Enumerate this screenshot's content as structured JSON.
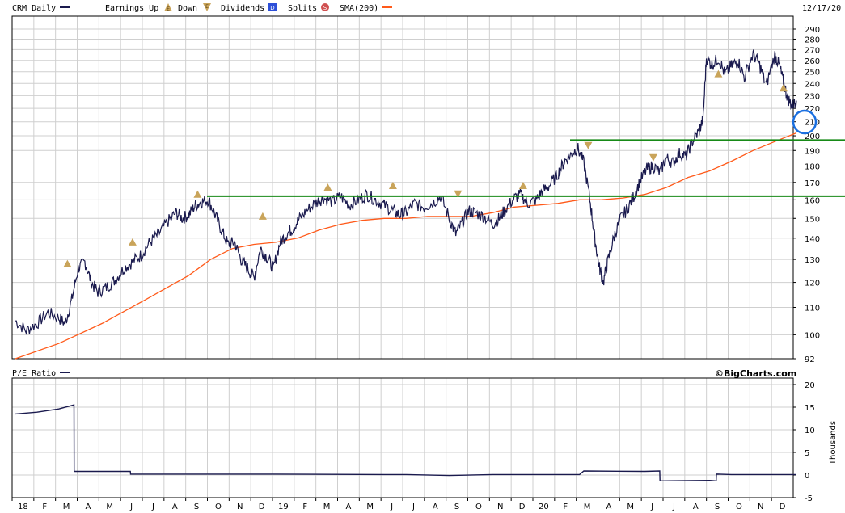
{
  "header": {
    "ticker_label": "CRM Daily",
    "earnings_label": "Earnings Up",
    "down_label": "Down",
    "dividends_label": "Dividends",
    "splits_label": "Splits",
    "sma_label": "SMA(200)",
    "date_label": "12/17/20",
    "earnings_icon": "E",
    "dividends_icon": "D",
    "splits_icon": "S"
  },
  "lower": {
    "pe_label": "P/E Ratio",
    "brand": "©BigCharts.com",
    "unit_label": "Thousands"
  },
  "colors": {
    "price": "#1a1a4e",
    "sma": "#ff5a1a",
    "trendline": "#178a17",
    "earnings_marker": "#c9a45a",
    "dividend": "#2d4fd8",
    "split": "#d05050",
    "highlight": "#1a6fe0",
    "grid": "#cfcfcf"
  },
  "chart_data": [
    {
      "type": "line",
      "name": "CRM Daily price chart",
      "y_scale": "log",
      "ylim": [
        92,
        290
      ],
      "y_ticks": [
        92,
        100,
        110,
        120,
        130,
        140,
        150,
        160,
        170,
        180,
        190,
        200,
        210,
        220,
        230,
        240,
        250,
        260,
        270,
        280,
        290
      ],
      "x_ticks": [
        "18",
        "F",
        "M",
        "A",
        "M",
        "J",
        "J",
        "A",
        "S",
        "O",
        "N",
        "D",
        "19",
        "F",
        "M",
        "A",
        "M",
        "J",
        "J",
        "A",
        "S",
        "O",
        "N",
        "D",
        "20",
        "F",
        "M",
        "A",
        "M",
        "J",
        "J",
        "A",
        "S",
        "O",
        "N",
        "D"
      ],
      "series": [
        {
          "name": "CRM Daily",
          "points": [
            [
              0,
              105
            ],
            [
              0.5,
              101.5
            ],
            [
              1,
              104
            ],
            [
              1.5,
              108
            ],
            [
              2,
              106
            ],
            [
              2.3,
              104
            ],
            [
              2.6,
              113
            ],
            [
              2.9,
              126
            ],
            [
              3.2,
              129
            ],
            [
              3.5,
              120
            ],
            [
              3.8,
              116
            ],
            [
              4.2,
              118
            ],
            [
              4.6,
              121
            ],
            [
              5,
              126
            ],
            [
              5.4,
              129
            ],
            [
              5.8,
              132
            ],
            [
              6.2,
              138
            ],
            [
              6.6,
              142
            ],
            [
              7,
              148
            ],
            [
              7.4,
              153
            ],
            [
              7.7,
              150
            ],
            [
              8,
              152
            ],
            [
              8.3,
              157
            ],
            [
              8.6,
              159
            ],
            [
              8.9,
              160
            ],
            [
              9.2,
              152
            ],
            [
              9.5,
              144
            ],
            [
              9.8,
              137
            ],
            [
              10.1,
              138
            ],
            [
              10.4,
              130
            ],
            [
              10.7,
              126
            ],
            [
              11,
              122
            ],
            [
              11.3,
              135
            ],
            [
              11.6,
              131
            ],
            [
              11.9,
              126
            ],
            [
              12.2,
              138
            ],
            [
              12.5,
              142
            ],
            [
              12.8,
              145
            ],
            [
              13.1,
              150
            ],
            [
              13.5,
              155
            ],
            [
              13.9,
              159
            ],
            [
              14.2,
              161
            ],
            [
              14.6,
              159
            ],
            [
              15,
              162
            ],
            [
              15.4,
              157
            ],
            [
              15.8,
              160
            ],
            [
              16.2,
              163
            ],
            [
              16.6,
              160
            ],
            [
              17,
              157
            ],
            [
              17.4,
              154
            ],
            [
              17.7,
              152
            ],
            [
              18,
              153
            ],
            [
              18.4,
              158
            ],
            [
              18.8,
              156
            ],
            [
              19.2,
              158
            ],
            [
              19.6,
              162
            ],
            [
              20,
              150
            ],
            [
              20.3,
              142
            ],
            [
              20.6,
              148
            ],
            [
              20.9,
              154
            ],
            [
              21.2,
              153
            ],
            [
              21.6,
              151
            ],
            [
              22,
              147
            ],
            [
              22.3,
              150
            ],
            [
              22.6,
              155
            ],
            [
              23,
              161
            ],
            [
              23.3,
              163
            ],
            [
              23.6,
              158
            ],
            [
              24,
              160
            ],
            [
              24.3,
              165
            ],
            [
              24.6,
              168
            ],
            [
              25,
              175
            ],
            [
              25.3,
              183
            ],
            [
              25.6,
              187
            ],
            [
              25.9,
              192
            ],
            [
              26.2,
              182
            ],
            [
              26.5,
              158
            ],
            [
              26.7,
              140
            ],
            [
              26.9,
              127
            ],
            [
              27.1,
              120
            ],
            [
              27.3,
              129
            ],
            [
              27.6,
              141
            ],
            [
              27.9,
              150
            ],
            [
              28.2,
              155
            ],
            [
              28.5,
              162
            ],
            [
              28.8,
              171
            ],
            [
              29.1,
              178
            ],
            [
              29.4,
              180
            ],
            [
              29.7,
              176
            ],
            [
              30,
              185
            ],
            [
              30.3,
              182
            ],
            [
              30.6,
              188
            ],
            [
              30.9,
              186
            ],
            [
              31.2,
              196
            ],
            [
              31.5,
              203
            ],
            [
              31.7,
              212
            ],
            [
              31.85,
              262
            ],
            [
              32.1,
              256
            ],
            [
              32.4,
              262
            ],
            [
              32.7,
              248
            ],
            [
              33,
              255
            ],
            [
              33.3,
              260
            ],
            [
              33.6,
              245
            ],
            [
              34,
              266
            ],
            [
              34.3,
              256
            ],
            [
              34.6,
              238
            ],
            [
              35,
              265
            ],
            [
              35.2,
              256
            ],
            [
              35.4,
              241
            ],
            [
              35.6,
              228
            ],
            [
              35.8,
              222
            ],
            [
              36,
              226
            ]
          ]
        },
        {
          "name": "SMA(200)",
          "points": [
            [
              0,
              92
            ],
            [
              2,
              97
            ],
            [
              4,
              104
            ],
            [
              6,
              113
            ],
            [
              8,
              123
            ],
            [
              9,
              130
            ],
            [
              10,
              135
            ],
            [
              11,
              137
            ],
            [
              12,
              138
            ],
            [
              13,
              140
            ],
            [
              14,
              144
            ],
            [
              15,
              147
            ],
            [
              16,
              149
            ],
            [
              17,
              150
            ],
            [
              18,
              150
            ],
            [
              19,
              151
            ],
            [
              20,
              151
            ],
            [
              21,
              151
            ],
            [
              22,
              153
            ],
            [
              23,
              156
            ],
            [
              24,
              157
            ],
            [
              25,
              158
            ],
            [
              26,
              160
            ],
            [
              27,
              160
            ],
            [
              28,
              161
            ],
            [
              29,
              163
            ],
            [
              30,
              167
            ],
            [
              31,
              173
            ],
            [
              32,
              177
            ],
            [
              33,
              183
            ],
            [
              34,
              190
            ],
            [
              35,
              196
            ],
            [
              36,
              202
            ]
          ]
        }
      ],
      "trendlines": [
        {
          "name": "resistance 162",
          "y": 162
        },
        {
          "name": "resistance 197",
          "y": 197
        }
      ],
      "earnings_markers": [
        {
          "x": 2.4,
          "y": 128,
          "dir": "up"
        },
        {
          "x": 5.4,
          "y": 138,
          "dir": "up"
        },
        {
          "x": 8.4,
          "y": 163,
          "dir": "up"
        },
        {
          "x": 11.4,
          "y": 151,
          "dir": "up"
        },
        {
          "x": 14.4,
          "y": 167,
          "dir": "up"
        },
        {
          "x": 17.4,
          "y": 168,
          "dir": "up"
        },
        {
          "x": 20.4,
          "y": 163,
          "dir": "down"
        },
        {
          "x": 23.4,
          "y": 168,
          "dir": "up"
        },
        {
          "x": 26.4,
          "y": 193,
          "dir": "down"
        },
        {
          "x": 29.4,
          "y": 185,
          "dir": "down"
        },
        {
          "x": 32.4,
          "y": 248,
          "dir": "up"
        },
        {
          "x": 35.4,
          "y": 236,
          "dir": "up"
        }
      ]
    },
    {
      "type": "line",
      "name": "P/E Ratio",
      "ylim": [
        -5,
        20
      ],
      "y_ticks": [
        -5,
        0,
        5,
        10,
        15,
        20
      ],
      "ylabel": "Thousands",
      "series": [
        {
          "name": "P/E Ratio",
          "points": [
            [
              0,
              13.5
            ],
            [
              1,
              13.9
            ],
            [
              2,
              14.6
            ],
            [
              2.7,
              15.5
            ],
            [
              2.71,
              0.8
            ],
            [
              5.3,
              0.8
            ],
            [
              5.31,
              0.2
            ],
            [
              8,
              0.2
            ],
            [
              12,
              0.2
            ],
            [
              17,
              0.1
            ],
            [
              18,
              0.1
            ],
            [
              20,
              -0.1
            ],
            [
              22,
              0.1
            ],
            [
              26,
              0.1
            ],
            [
              26.2,
              0.9
            ],
            [
              29,
              0.8
            ],
            [
              29.7,
              0.9
            ],
            [
              29.71,
              -1.3
            ],
            [
              32,
              -1.2
            ],
            [
              32.3,
              -1.3
            ],
            [
              32.31,
              0.2
            ],
            [
              33,
              0.1
            ],
            [
              36,
              0.1
            ]
          ]
        }
      ]
    }
  ]
}
